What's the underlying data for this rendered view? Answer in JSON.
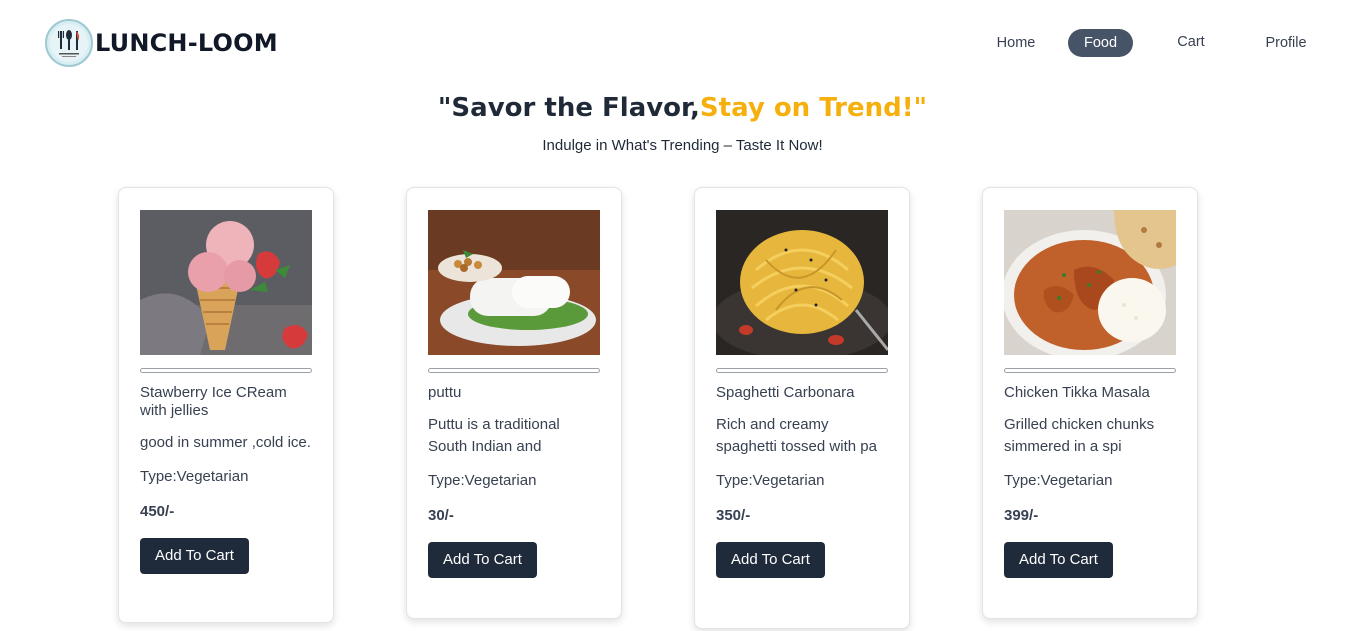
{
  "brand": {
    "name": "LUNCH-LOOM",
    "logo_icon": "fork-knife-logo-icon"
  },
  "nav": {
    "items": [
      {
        "label": "Home",
        "active": false
      },
      {
        "label": "Food",
        "active": true
      },
      {
        "label": "Cart",
        "active": false
      },
      {
        "label": "Profile",
        "active": false
      }
    ],
    "active_color": "#475467"
  },
  "hero": {
    "title_part1": "\"Savor the Flavor,",
    "title_part2": "Stay on Trend!\"",
    "accent_color": "#f5b00e",
    "subtitle": "Indulge in What's Trending – Taste It Now!"
  },
  "cards": [
    {
      "title": "Stawberry Ice CReam with jellies",
      "description": "good in summer ,cold ice.",
      "type": "Type:Vegetarian",
      "price": "450/-",
      "button": "Add To Cart",
      "image_icon": "strawberry-ice-cream-image"
    },
    {
      "title": "puttu",
      "description": "Puttu is a traditional South Indian and",
      "type": "Type:Vegetarian",
      "price": "30/-",
      "button": "Add To Cart",
      "image_icon": "puttu-image"
    },
    {
      "title": "Spaghetti Carbonara",
      "description": "Rich and creamy spaghetti tossed with pa",
      "type": "Type:Vegetarian",
      "price": "350/-",
      "button": "Add To Cart",
      "image_icon": "spaghetti-image"
    },
    {
      "title": "Chicken Tikka Masala",
      "description": "Grilled chicken chunks simmered in a spi",
      "type": "Type:Vegetarian",
      "price": "399/-",
      "button": "Add To Cart",
      "image_icon": "chicken-tikka-image"
    }
  ],
  "button_color": "#1f2a3a"
}
